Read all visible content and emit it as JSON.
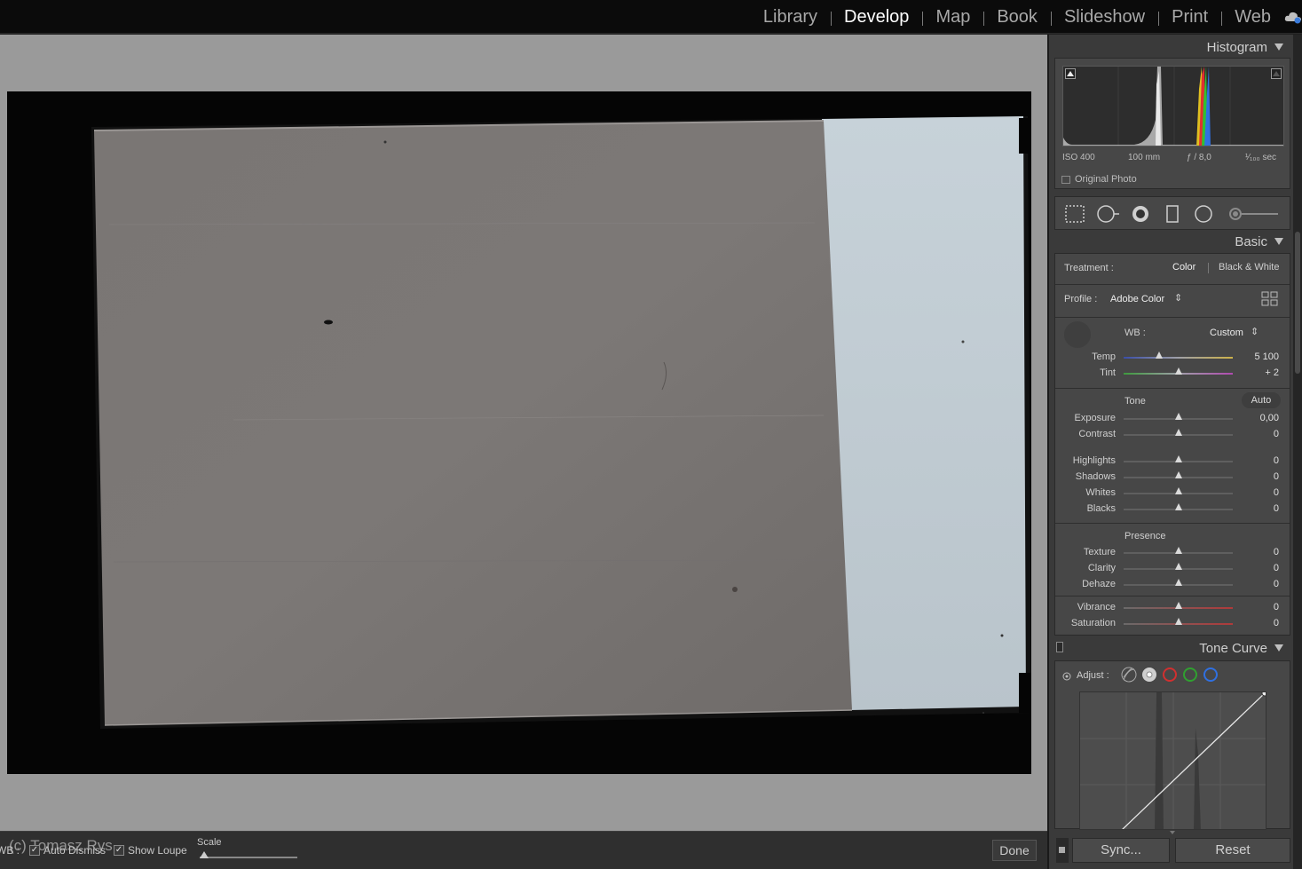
{
  "modules": [
    "Library",
    "Develop",
    "Map",
    "Book",
    "Slideshow",
    "Print",
    "Web"
  ],
  "active_module": "Develop",
  "histogram": {
    "title": "Histogram",
    "iso": "ISO 400",
    "focal": "100 mm",
    "aperture": "ƒ / 8,0",
    "shutter": "¹⁄₁₀₀ sec",
    "original_photo": "Original Photo"
  },
  "basic": {
    "title": "Basic",
    "treatment_label": "Treatment :",
    "treatment_color": "Color",
    "treatment_bw": "Black & White",
    "profile_label": "Profile :",
    "profile_value": "Adobe Color",
    "wb_label": "WB :",
    "wb_value": "Custom",
    "temp": {
      "label": "Temp",
      "value": "5 100"
    },
    "tint": {
      "label": "Tint",
      "value": "+ 2"
    },
    "tone_title": "Tone",
    "auto": "Auto",
    "exposure": {
      "label": "Exposure",
      "value": "0,00"
    },
    "contrast": {
      "label": "Contrast",
      "value": "0"
    },
    "highlights": {
      "label": "Highlights",
      "value": "0"
    },
    "shadows": {
      "label": "Shadows",
      "value": "0"
    },
    "whites": {
      "label": "Whites",
      "value": "0"
    },
    "blacks": {
      "label": "Blacks",
      "value": "0"
    },
    "presence_title": "Presence",
    "texture": {
      "label": "Texture",
      "value": "0"
    },
    "clarity": {
      "label": "Clarity",
      "value": "0"
    },
    "dehaze": {
      "label": "Dehaze",
      "value": "0"
    },
    "vibrance": {
      "label": "Vibrance",
      "value": "0"
    },
    "saturation": {
      "label": "Saturation",
      "value": "0"
    }
  },
  "tone_curve": {
    "title": "Tone Curve",
    "adjust_label": "Adjust :"
  },
  "buttons": {
    "sync": "Sync...",
    "reset": "Reset",
    "done": "Done"
  },
  "toolbar": {
    "wb": "WB :",
    "auto_dismiss": "Auto Dismiss",
    "show_loupe": "Show Loupe",
    "scale": "Scale",
    "watermark": "(c) Tomasz Rys"
  },
  "colors": {
    "accent_red": "#d03030",
    "accent_green": "#30a030",
    "accent_blue": "#3070e0"
  }
}
